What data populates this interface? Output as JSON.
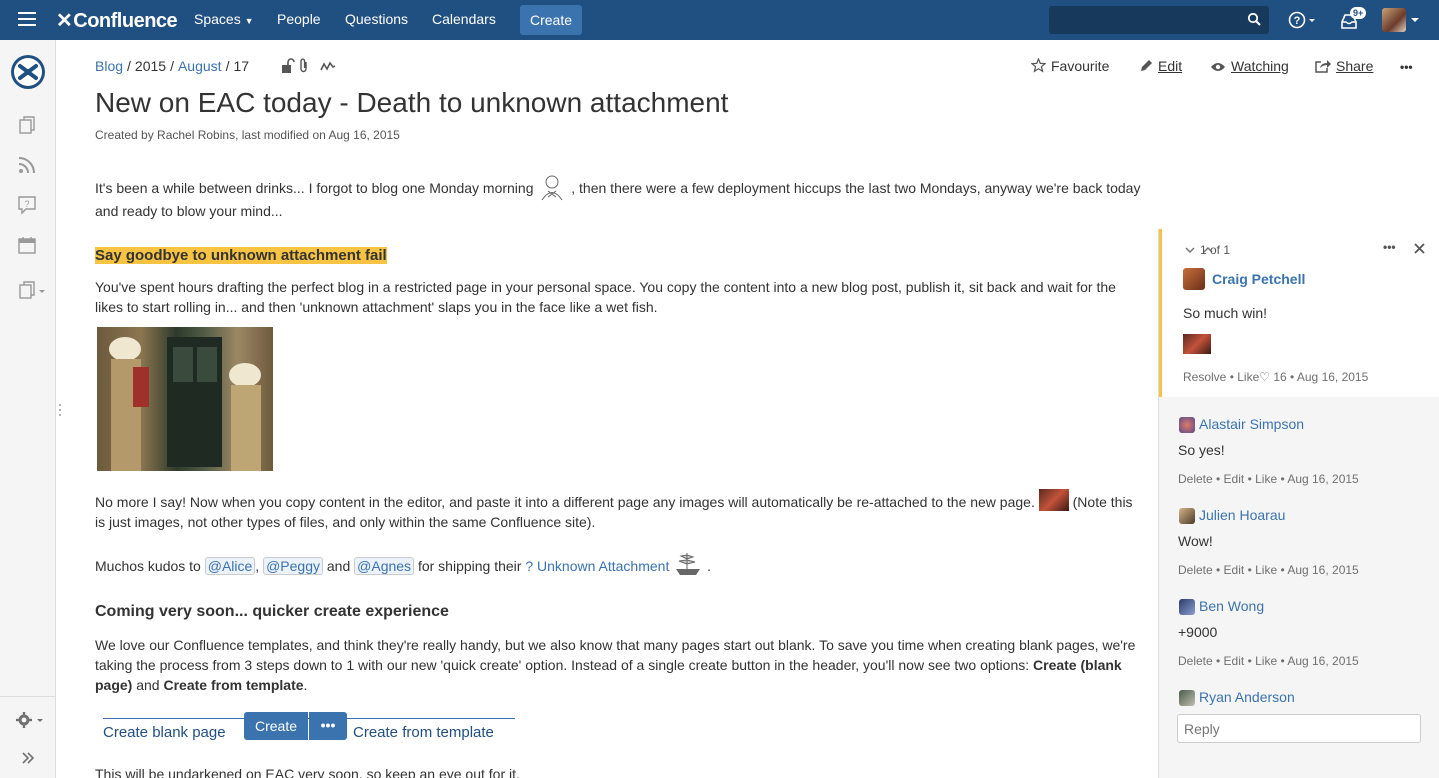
{
  "nav": {
    "logo": "Confluence",
    "spaces": "Spaces",
    "people": "People",
    "questions": "Questions",
    "calendars": "Calendars",
    "create": "Create",
    "search_placeholder": "",
    "notif_badge": "9+"
  },
  "breadcrumb": {
    "blog": "Blog",
    "year": "2015",
    "month": "August",
    "day": "17"
  },
  "actions": {
    "favourite": "Favourite",
    "edit": "Edit",
    "watching": "Watching",
    "share": "Share",
    "more": "•••"
  },
  "page": {
    "title": "New on EAC today - Death to unknown attachment",
    "byline": "Created by Rachel Robins, last modified on Aug 16, 2015",
    "intro_a": "It's been a while between drinks... I forgot to blog one Monday morning ",
    "intro_b": " , then there were a few deployment hiccups the last two Mondays, anyway we're back today and ready to blow your mind...",
    "heading1": "Say goodbye to unknown attachment fail",
    "para1": "You've spent hours drafting the perfect blog in a restricted page in your personal space. You copy the content into a new blog post, publish it, sit back and wait for the likes to start rolling in... and then 'unknown attachment' slaps you in the face like a wet fish.",
    "para2_a": "No more I say!  Now when you copy content in the editor, and paste it into a different page any images will automatically be re-attached to the new page. ",
    "para2_b": " (Note this is just images, not other types of files, and only within the same Confluence site).",
    "kudos_a": "Muchos kudos to ",
    "mention1": "@Alice",
    "comma": ", ",
    "mention2": "@Peggy",
    "and": " and ",
    "mention3": "@Agnes",
    "kudos_b": " for shipping their ",
    "kudos_link": "? Unknown Attachment",
    "kudos_end": " .",
    "heading2": "Coming very soon... quicker create experience",
    "para3_a": "We love our Confluence templates, and think they're really handy, but we also know that many pages start out blank. To save you time when creating blank pages, we're taking the process from 3 steps down to 1 with our new 'quick create' option. Instead of a single create button in the header, you'll now see two options: ",
    "para3_b1": "Create (blank page)",
    "para3_and": " and ",
    "para3_b2": "Create from template",
    "para3_end": ".",
    "demo_blank": "Create blank page",
    "demo_create": "Create",
    "demo_more": "•••",
    "demo_template": "Create from template",
    "para4": "This will be undarkened on EAC very soon, so keep an eye out for it."
  },
  "comments": {
    "counter": "1 of 1",
    "thread": {
      "user": "Craig Petchell",
      "body": "So much win!",
      "meta": "Resolve • Like♡ 16 • Aug 16, 2015"
    },
    "replies": [
      {
        "user": "Alastair Simpson",
        "body": "So yes!",
        "meta": "Delete • Edit • Like • Aug 16, 2015"
      },
      {
        "user": "Julien Hoarau",
        "body": "Wow!",
        "meta": "Delete • Edit • Like • Aug 16, 2015"
      },
      {
        "user": "Ben Wong",
        "body": "+9000",
        "meta": "Delete • Edit • Like • Aug 16, 2015"
      }
    ],
    "last_user": "Ryan Anderson",
    "reply_placeholder": "Reply"
  }
}
